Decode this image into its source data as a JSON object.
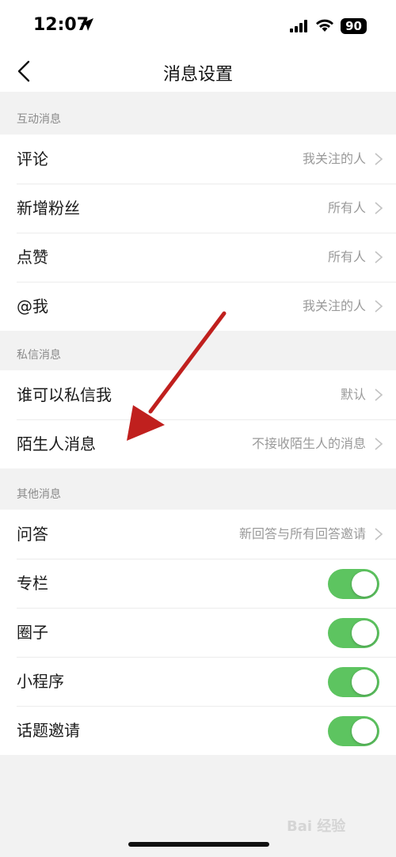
{
  "status_bar": {
    "time": "12:07",
    "battery": "90"
  },
  "nav": {
    "title": "消息设置"
  },
  "sections": {
    "interaction": {
      "header": "互动消息",
      "rows": [
        {
          "label": "评论",
          "value": "我关注的人"
        },
        {
          "label": "新增粉丝",
          "value": "所有人"
        },
        {
          "label": "点赞",
          "value": "所有人"
        },
        {
          "label": "@我",
          "value": "我关注的人"
        }
      ]
    },
    "private": {
      "header": "私信消息",
      "rows": [
        {
          "label": "谁可以私信我",
          "value": "默认"
        },
        {
          "label": "陌生人消息",
          "value": "不接收陌生人的消息"
        }
      ]
    },
    "other": {
      "header": "其他消息",
      "rows": [
        {
          "label": "问答",
          "value": "新回答与所有回答邀请"
        },
        {
          "label": "专栏",
          "toggle_on": true
        },
        {
          "label": "圈子",
          "toggle_on": true
        },
        {
          "label": "小程序",
          "toggle_on": true
        },
        {
          "label": "话题邀请",
          "toggle_on": true
        }
      ]
    }
  },
  "colors": {
    "toggle_on": "#5dc460",
    "annotation_arrow": "#c0201e"
  },
  "watermark": "Bai 经验"
}
